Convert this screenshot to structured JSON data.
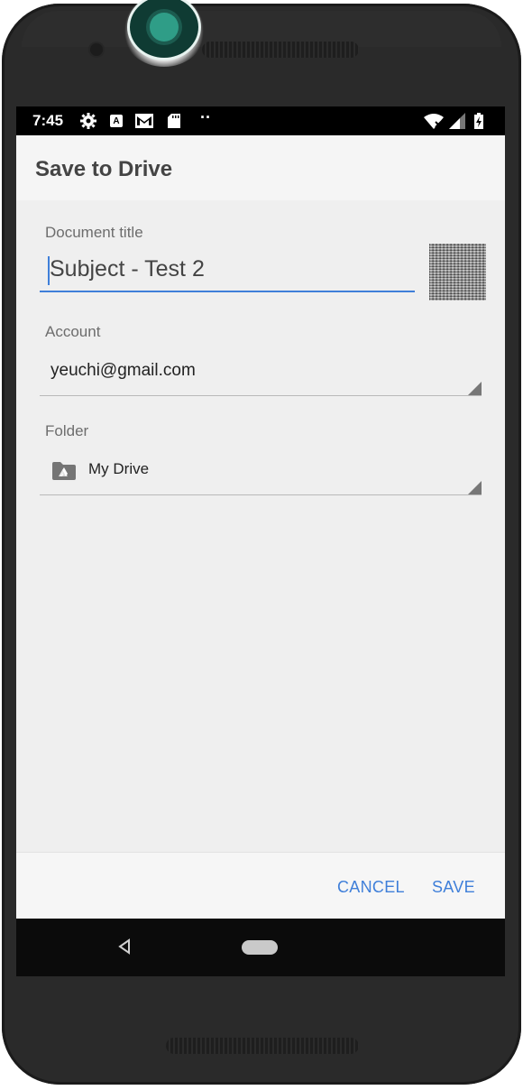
{
  "status_bar": {
    "time": "7:45",
    "icons": [
      "settings-icon",
      "a-badge-icon",
      "gmail-icon",
      "sd-card-icon",
      "more-notifications-dots",
      "wifi-icon",
      "signal-icon",
      "battery-charging-icon"
    ],
    "dots": "··"
  },
  "app_bar": {
    "title": "Save to Drive"
  },
  "form": {
    "document_title_label": "Document title",
    "document_title_value": "Subject - Test 2",
    "account_label": "Account",
    "account_value": "yeuchi@gmail.com",
    "folder_label": "Folder",
    "folder_value": "My Drive",
    "folder_icon": "drive-folder-icon"
  },
  "actions": {
    "cancel_label": "CANCEL",
    "save_label": "SAVE"
  },
  "nav_bar": {
    "icons": [
      "back-icon",
      "home-icon"
    ]
  },
  "colors": {
    "accent": "#3f7fd9",
    "status_bar": "#000000",
    "screen_bg": "#efefef",
    "app_bar_bg": "#f5f5f5"
  }
}
